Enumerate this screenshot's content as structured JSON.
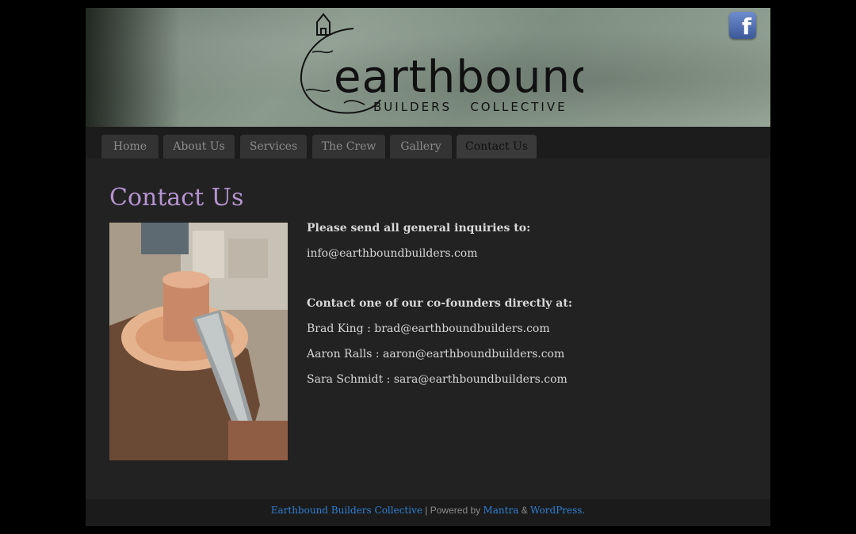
{
  "header": {
    "logo_word": "earthbound",
    "logo_sub": "BUILDERS   COLLECTIVE",
    "facebook_glyph": "f"
  },
  "nav": {
    "items": [
      {
        "label": "Home"
      },
      {
        "label": "About Us"
      },
      {
        "label": "Services"
      },
      {
        "label": "The Crew"
      },
      {
        "label": "Gallery"
      },
      {
        "label": "Contact Us"
      }
    ],
    "active": "Contact Us"
  },
  "content": {
    "title": "Contact Us",
    "general_heading": "Please send all general inquiries to:",
    "general_email": "info@earthboundbuilders.com",
    "founders_heading": "Contact one of our co-founders directly at:",
    "contacts": [
      {
        "text": "Brad King : brad@earthboundbuilders.com"
      },
      {
        "text": "Aaron Ralls : aaron@earthboundbuilders.com"
      },
      {
        "text": "Sara Schmidt : sara@earthboundbuilders.com"
      }
    ]
  },
  "footer": {
    "site_link": "Earthbound Builders Collective",
    "powered_by": " | Powered by ",
    "theme_link": "Mantra",
    "amp": " & ",
    "wp_link": "WordPress."
  },
  "colors": {
    "accent_title": "#b693d1",
    "link": "#2f7fd4",
    "background": "#222222"
  }
}
